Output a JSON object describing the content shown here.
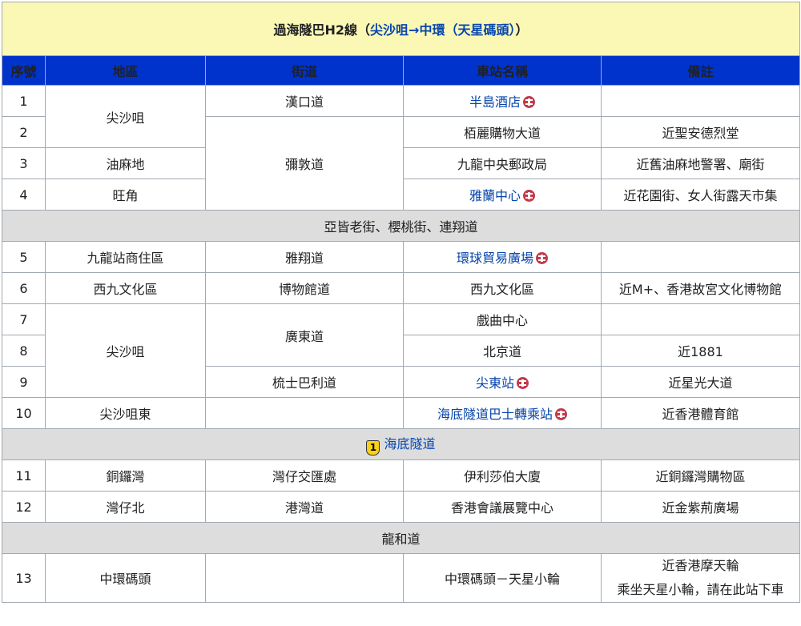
{
  "title": {
    "prefix": "過海隧巴H2線（",
    "from": "尖沙咀",
    "arrow": "→",
    "to": "中環（天星碼頭）",
    "suffix": "）"
  },
  "headers": [
    "序號",
    "地區",
    "街道",
    "車站名稱",
    "備註"
  ],
  "rows": {
    "r1": {
      "no": "1",
      "district": "尖沙咀",
      "street": "漢口道",
      "station": "半島酒店",
      "note": ""
    },
    "r2": {
      "no": "2",
      "street": "彌敦道",
      "station": "栢麗購物大道",
      "note": "近聖安德烈堂"
    },
    "r3": {
      "no": "3",
      "district": "油麻地",
      "station": "九龍中央郵政局",
      "note": "近舊油麻地警署、廟街"
    },
    "r4": {
      "no": "4",
      "district": "旺角",
      "station": "雅蘭中心",
      "note": "近花園街、女人街露天市集"
    },
    "sep1": "亞皆老街、櫻桃街、連翔道",
    "r5": {
      "no": "5",
      "district": "九龍站商住區",
      "street": "雅翔道",
      "station": "環球貿易廣場",
      "note": ""
    },
    "r6": {
      "no": "6",
      "district": "西九文化區",
      "street": "博物館道",
      "station": "西九文化區",
      "note": "近M+、香港故宮文化博物館"
    },
    "r7": {
      "no": "7",
      "district": "尖沙咀",
      "street": "廣東道",
      "station": "戲曲中心",
      "note": ""
    },
    "r8": {
      "no": "8",
      "station": "北京道",
      "note": "近1881"
    },
    "r9": {
      "no": "9",
      "street": "梳士巴利道",
      "station": "尖東站",
      "note": "近星光大道"
    },
    "r10": {
      "no": "10",
      "district": "尖沙咀東",
      "street": "",
      "station": "海底隧道巴士轉乘站",
      "note": "近香港體育館"
    },
    "sep2": {
      "shield": "1",
      "text": "海底隧道"
    },
    "r11": {
      "no": "11",
      "district": "銅鑼灣",
      "street": "灣仔交匯處",
      "station": "伊利莎伯大廈",
      "note": "近銅鑼灣購物區"
    },
    "r12": {
      "no": "12",
      "district": "灣仔北",
      "street": "港灣道",
      "station": "香港會議展覽中心",
      "note": "近金紫荊廣場"
    },
    "sep3": "龍和道",
    "r13": {
      "no": "13",
      "district": "中環碼頭",
      "street": "",
      "station": "中環碼頭－天星小輪",
      "note_lines": [
        "近香港摩天輪",
        "乘坐天星小輪，請在此站下車"
      ]
    }
  },
  "icons": {
    "mtr": "mtr-logo-icon",
    "shield": "route-shield-icon"
  },
  "colors": {
    "title_bg": "#fbf7b5",
    "header_bg": "#0033cc",
    "link": "#0645ad",
    "separator_bg": "#dddddd",
    "mtr_red": "#c23a4b",
    "shield_yellow": "#f7d117"
  }
}
